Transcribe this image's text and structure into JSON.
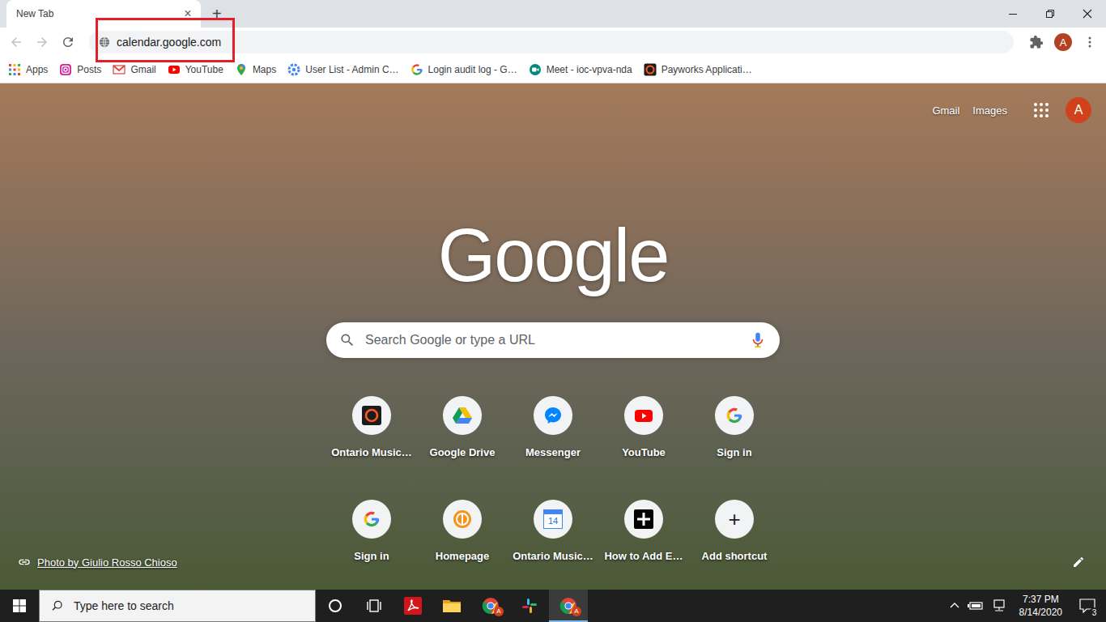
{
  "window": {
    "tab": {
      "title": "New Tab",
      "close": "×",
      "selected": true
    },
    "new_tab": "+"
  },
  "toolbar": {
    "back_enabled": false,
    "forward_enabled": false,
    "address": "calendar.google.com",
    "address_highlighted": true,
    "profile": "A"
  },
  "bookmarks": [
    {
      "label": "Apps",
      "kind": "apps"
    },
    {
      "label": "Posts",
      "kind": "instagram"
    },
    {
      "label": "Gmail",
      "kind": "gmail"
    },
    {
      "label": "YouTube",
      "kind": "youtube"
    },
    {
      "label": "Maps",
      "kind": "maps"
    },
    {
      "label": "User List - Admin C…",
      "kind": "admin"
    },
    {
      "label": "Login audit log - G…",
      "kind": "google"
    },
    {
      "label": "Meet - ioc-vpva-nda",
      "kind": "meet"
    },
    {
      "label": "Payworks Applicati…",
      "kind": "ring"
    }
  ],
  "page": {
    "links": [
      "Gmail",
      "Images"
    ],
    "account": "A",
    "logo": "Google",
    "search": {
      "placeholder": "Search Google or type a URL"
    },
    "shortcuts": [
      {
        "label": "Ontario Music…",
        "kind": "ring",
        "icon_text": ""
      },
      {
        "label": "Google Drive",
        "kind": "drive",
        "icon_text": ""
      },
      {
        "label": "Messenger",
        "kind": "messenger",
        "icon_text": ""
      },
      {
        "label": "YouTube",
        "kind": "youtube",
        "icon_text": ""
      },
      {
        "label": "Sign in",
        "kind": "google",
        "icon_text": ""
      },
      {
        "label": "Sign in",
        "kind": "google",
        "icon_text": ""
      },
      {
        "label": "Homepage",
        "kind": "homepage",
        "icon_text": ""
      },
      {
        "label": "Ontario Music…",
        "kind": "calendar",
        "icon_text": "14"
      },
      {
        "label": "How to Add E…",
        "kind": "black-plus",
        "icon_text": ""
      },
      {
        "label": "Add shortcut",
        "kind": "add",
        "icon_text": "+"
      }
    ],
    "photo_credit": "Photo by Giulio Rosso Chioso"
  },
  "taskbar": {
    "search_placeholder": "Type here to search",
    "apps": [
      {
        "kind": "cortana",
        "badge": "",
        "active": false
      },
      {
        "kind": "taskview",
        "badge": "",
        "active": false
      },
      {
        "kind": "acrobat",
        "badge": "",
        "active": false
      },
      {
        "kind": "explorer",
        "badge": "",
        "active": false
      },
      {
        "kind": "chrome",
        "badge": "A",
        "active": false
      },
      {
        "kind": "slack",
        "badge": "",
        "active": false
      },
      {
        "kind": "chrome",
        "badge": "A",
        "active": true
      }
    ],
    "time": "7:37 PM",
    "date": "8/14/2020",
    "notifications": "3"
  }
}
